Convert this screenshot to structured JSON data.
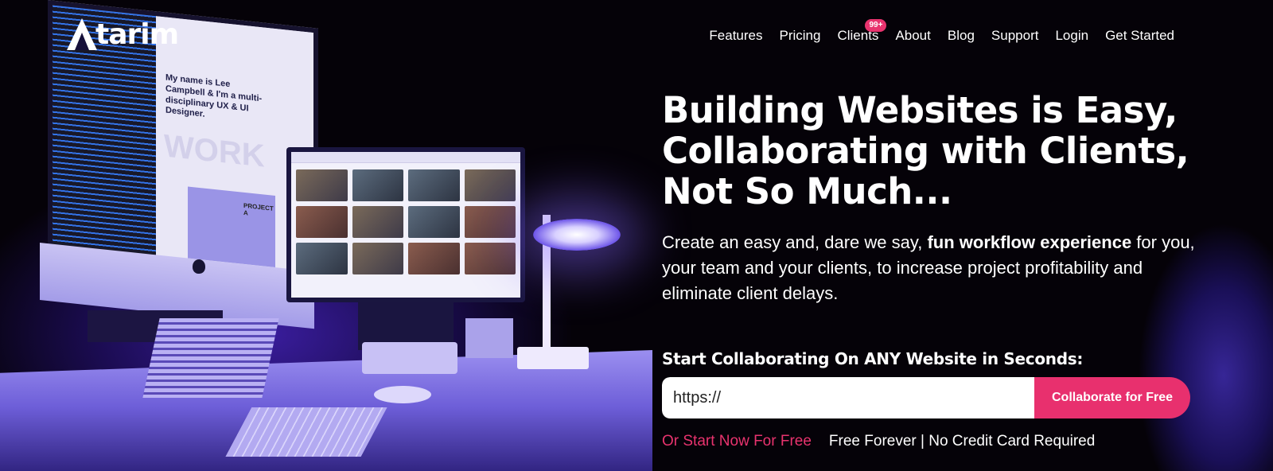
{
  "brand": {
    "name": "tarim",
    "accent_color": "#e8336e",
    "background_color": "#050208"
  },
  "nav": {
    "items": [
      {
        "label": "Features"
      },
      {
        "label": "Pricing"
      },
      {
        "label": "Clients",
        "badge": "99+"
      },
      {
        "label": "About"
      },
      {
        "label": "Blog"
      },
      {
        "label": "Support"
      },
      {
        "label": "Login"
      },
      {
        "label": "Get Started"
      }
    ]
  },
  "hero": {
    "headline_lines": [
      "Building Websites is Easy,",
      "Collaborating with Clients,",
      "Not So Much..."
    ],
    "subtitle_before": "Create an easy and, dare we say, ",
    "subtitle_bold": "fun workflow experience",
    "subtitle_after": " for you, your team and your clients, to increase project profitability and eliminate client delays.",
    "cta_title": "Start Collaborating On ANY Website in Seconds:",
    "url_input_value": "https://",
    "cta_button": "Collaborate for Free",
    "start_link": "Or Start Now For Free",
    "note": "Free Forever | No Credit Card Required"
  },
  "illustration": {
    "imac_heading": "My name is Lee Campbell & I'm a multi-disciplinary UX & UI Designer.",
    "imac_word": "WORK",
    "imac_card": "PROJECT A"
  }
}
